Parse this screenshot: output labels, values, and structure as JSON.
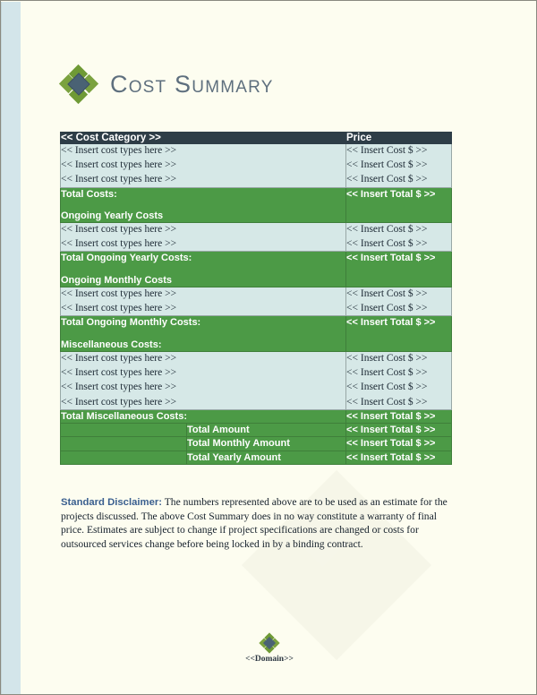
{
  "document": {
    "title": "Cost Summary",
    "logo_icon": "diamond-logo-icon"
  },
  "table": {
    "header": {
      "category": "<< Cost Category >>",
      "price": "Price"
    },
    "sections": [
      {
        "type": "items",
        "rows": [
          {
            "label": "<< Insert cost types here >>",
            "price": "<< Insert Cost $ >>"
          },
          {
            "label": "<< Insert cost types here >>",
            "price": "<< Insert Cost $ >>"
          },
          {
            "label": "<< Insert cost types here >>",
            "price": "<< Insert Cost $ >>"
          }
        ]
      },
      {
        "type": "total",
        "total_label": "Total Costs:",
        "next_section_label": "Ongoing Yearly Costs",
        "price": "<< Insert Total $ >>"
      },
      {
        "type": "items",
        "rows": [
          {
            "label": "<< Insert cost types here >>",
            "price": "<< Insert Cost $ >>"
          },
          {
            "label": "<< Insert cost types here >>",
            "price": "<< Insert Cost $ >>"
          }
        ]
      },
      {
        "type": "total",
        "total_label": "Total Ongoing Yearly Costs:",
        "next_section_label": "Ongoing Monthly Costs",
        "price": "<< Insert Total $ >>"
      },
      {
        "type": "items",
        "rows": [
          {
            "label": "<< Insert cost types here >>",
            "price": "<< Insert Cost $ >>"
          },
          {
            "label": "<< Insert cost types here >>",
            "price": "<< Insert Cost $ >>"
          }
        ]
      },
      {
        "type": "total",
        "total_label": "Total Ongoing Monthly Costs:",
        "next_section_label": "Miscellaneous Costs:",
        "price": "<< Insert Total $ >>"
      },
      {
        "type": "items",
        "rows": [
          {
            "label": "<< Insert cost types here >>",
            "price": "<< Insert Cost $ >>"
          },
          {
            "label": "<< Insert cost types here >>",
            "price": "<< Insert Cost $ >>"
          },
          {
            "label": "<< Insert cost types here >>",
            "price": "<< Insert Cost $ >>"
          },
          {
            "label": "<< Insert cost types here >>",
            "price": "<< Insert Cost $ >>"
          }
        ]
      },
      {
        "type": "total_single",
        "total_label": "Total Miscellaneous Costs:",
        "price": "<< Insert Total $ >>"
      }
    ],
    "grand_totals": [
      {
        "label": "Total Amount",
        "price": "<< Insert Total $ >>"
      },
      {
        "label": "Total Monthly Amount",
        "price": "<< Insert Total $ >>"
      },
      {
        "label": "Total Yearly Amount",
        "price": "<< Insert Total $ >>"
      }
    ]
  },
  "disclaimer": {
    "label": "Standard Disclaimer:",
    "body": " The numbers represented above are to be used as an estimate for the projects discussed. The above Cost Summary does in no way constitute a warranty of final price.  Estimates are subject to change if project specifications are changed or costs for outsourced services change before being locked in by a binding contract."
  },
  "footer": {
    "logo_icon": "diamond-logo-icon",
    "text": "<<Domain>>"
  },
  "colors": {
    "header_bar": "#2e3d47",
    "accent_green": "#4c9a46",
    "light_row": "#d6e8e7",
    "title_text": "#5e6f7e",
    "disclaimer_label": "#3a5f8f",
    "page_background": "#fdfdf0",
    "left_band": "#d3e5ea"
  }
}
